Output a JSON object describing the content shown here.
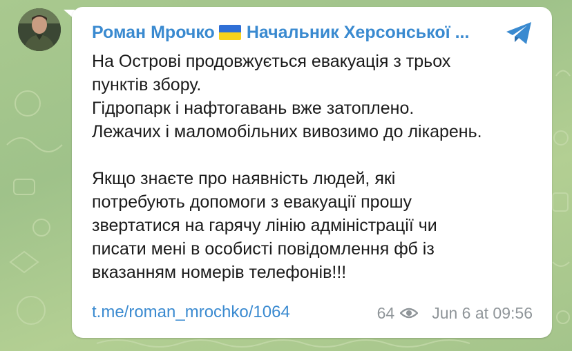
{
  "post": {
    "channel_name": "Роман Мрочко",
    "channel_title": "Начальник Херсонської ...",
    "flag_icon": "ukraine-flag-icon",
    "paragraph1": [
      "На Острові продовжується евакуація з трьох",
      "пунктів збору.",
      "Гідропарк і нафтогавань вже затоплено.",
      "Лежачих і маломобільних вивозимо до лікарень."
    ],
    "paragraph2": [
      "Якщо знаєте про наявність людей, які",
      "потребують допомоги з евакуації прошу",
      "звертатися на гарячу лінію адміністрації чи",
      "писати мені в особисті повідомлення фб із",
      "вказанням номерів телефонів!!!"
    ],
    "link": "t.me/roman_mrochko/1064",
    "views": "64",
    "views_icon": "eye-icon",
    "timestamp": "Jun 6 at 09:56",
    "share_icon": "telegram-share-icon"
  },
  "colors": {
    "accent": "#3a8ad0",
    "bubble": "#ffffff",
    "wallpaper": "#a9c98f",
    "meta": "#8f9599"
  }
}
